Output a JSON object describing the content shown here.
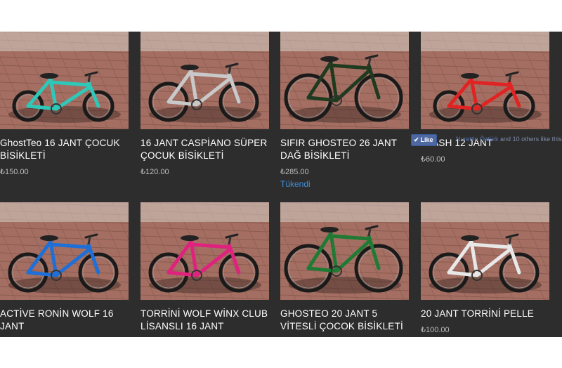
{
  "currency": "₺",
  "products": [
    {
      "title": "GhostTeo 16 JANT ÇOCUK BİSİKLETİ",
      "price": "₺150.00",
      "frame_color": "#2fc7b8",
      "wheel": "small"
    },
    {
      "title": "16 JANT CASPİANO SÜPER ÇOCUK BİSİKLETİ",
      "price": "₺120.00",
      "frame_color": "#c9c9c9",
      "wheel": "medium"
    },
    {
      "title": "SIFIR GHOSTEO 26 JANT DAĞ BİSİKLETİ",
      "price": "₺285.00",
      "stock_status": "Tükendi",
      "frame_color": "#1f3a1f",
      "wheel": "large"
    },
    {
      "title": "FLASH 12 JANT",
      "price": "₺60.00",
      "frame_color": "#e02424",
      "wheel": "small"
    },
    {
      "title": "ACTİVE RONİN WOLF 16 JANT",
      "price": "",
      "frame_color": "#1f6fd6",
      "wheel": "medium"
    },
    {
      "title": "TORRİNİ WOLF WİNX CLUB LİSANSLI 16 JANT",
      "price": "",
      "frame_color": "#e0227f",
      "wheel": "medium"
    },
    {
      "title": "GHOSTEO 20 JANT 5 VİTESLİ ÇOCOK BİSİKLETİ",
      "price": "",
      "frame_color": "#1f7a33",
      "wheel": "large"
    },
    {
      "title": "20 JANT TORRİNİ PELLE",
      "price": "₺100.00",
      "frame_color": "#e8e8e8",
      "wheel": "medium"
    }
  ],
  "facebook": {
    "like_label": "Like",
    "check_icon": "✔",
    "friend_name": "Nurettin Öztürk",
    "others_text": "and 10 others like this."
  }
}
